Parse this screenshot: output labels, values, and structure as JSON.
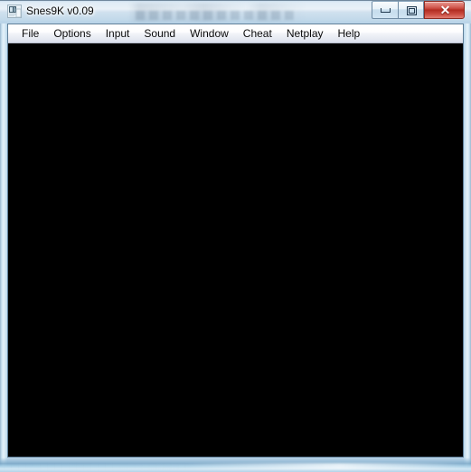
{
  "window": {
    "title": "Snes9K v0.09",
    "icon": "app-window-icon",
    "frame_color": "#b9d2e6",
    "client_border_color": "#5f7f99",
    "controls": {
      "minimize_label": "",
      "maximize_label": "",
      "close_label": "✕",
      "close_color": "#c03b30"
    }
  },
  "menubar": {
    "items": [
      {
        "label": "File",
        "name": "menu-file"
      },
      {
        "label": "Options",
        "name": "menu-options"
      },
      {
        "label": "Input",
        "name": "menu-input"
      },
      {
        "label": "Sound",
        "name": "menu-sound"
      },
      {
        "label": "Window",
        "name": "menu-window"
      },
      {
        "label": "Cheat",
        "name": "menu-cheat"
      },
      {
        "label": "Netplay",
        "name": "menu-netplay"
      },
      {
        "label": "Help",
        "name": "menu-help"
      }
    ]
  },
  "screen": {
    "content": "",
    "background_color": "#000000"
  }
}
